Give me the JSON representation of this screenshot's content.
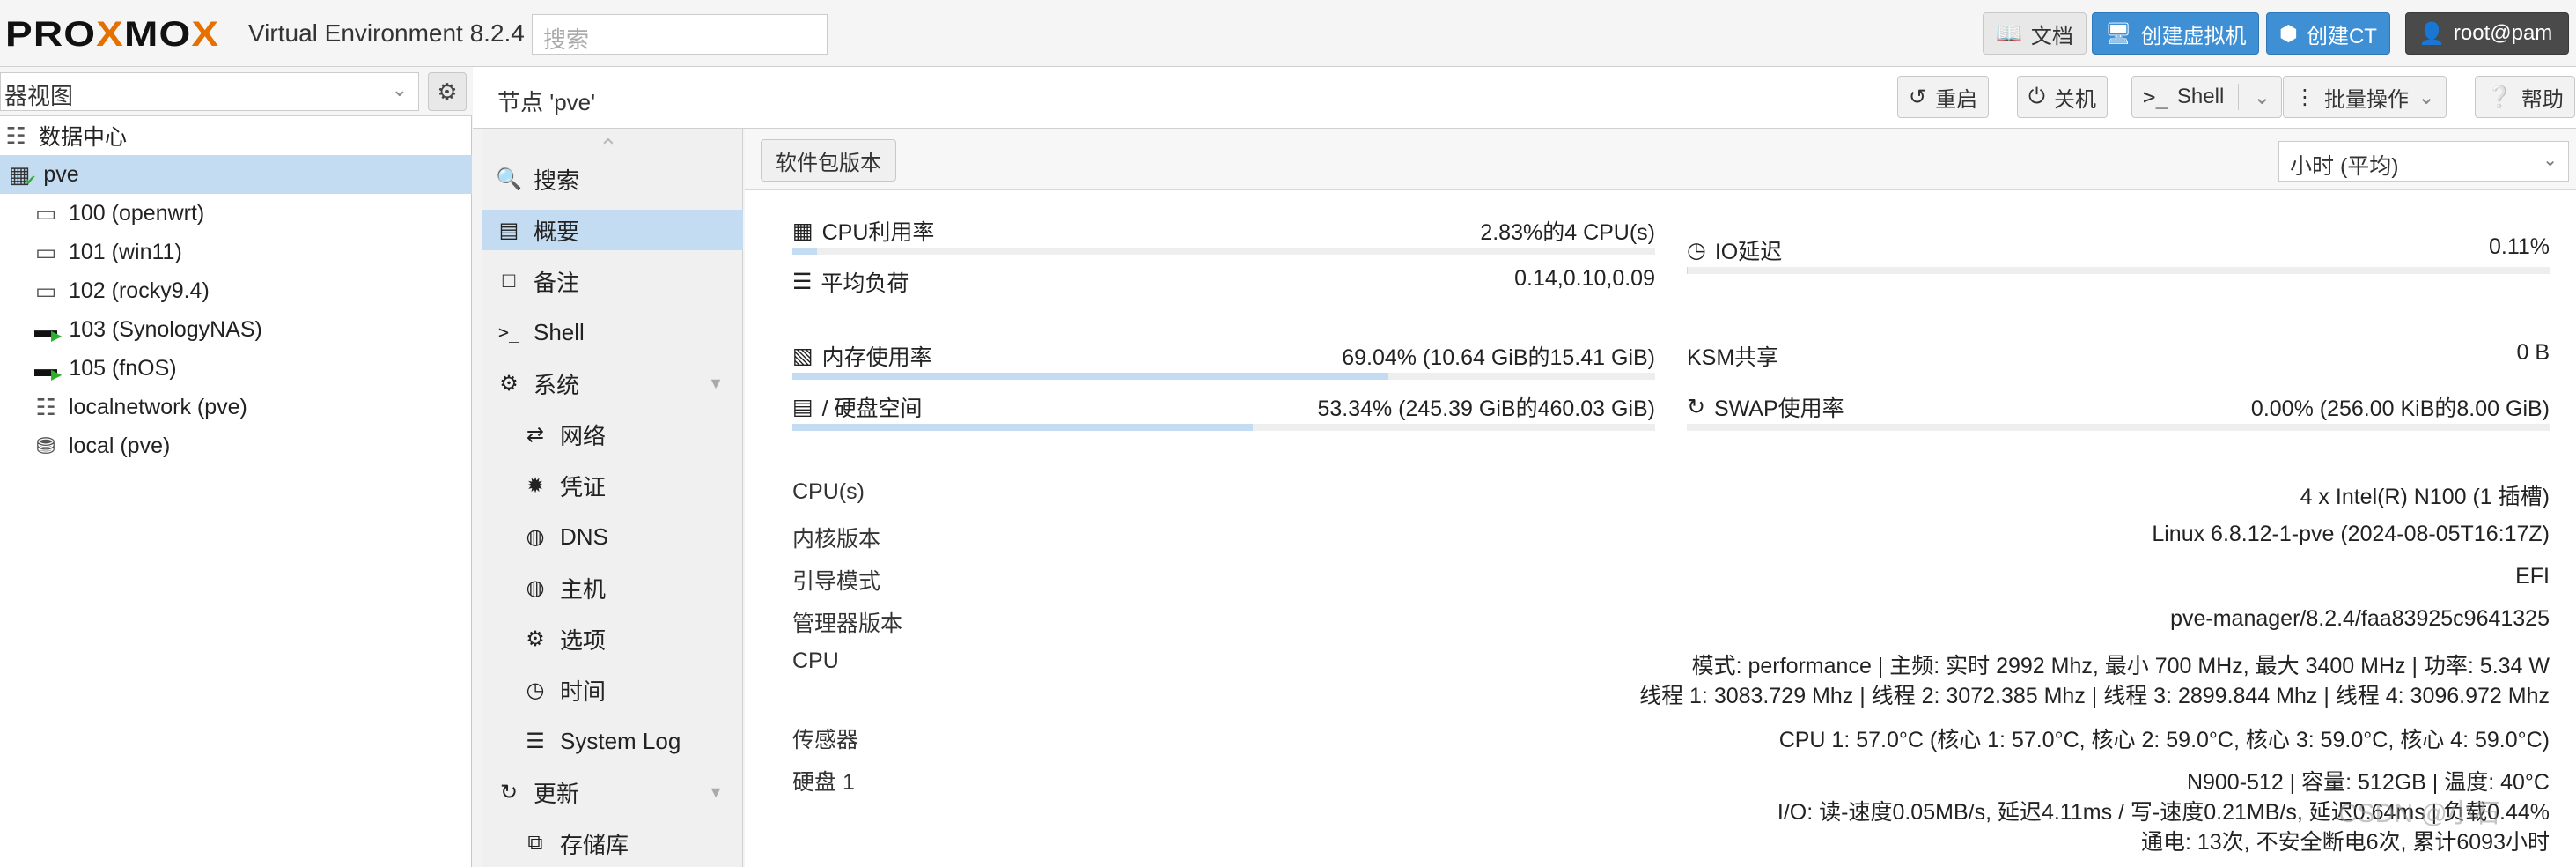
{
  "topbar": {
    "logo_prefix": "PRO",
    "logo_x": "X",
    "logo_suffix": "MO",
    "logo_x2": "X",
    "version": "Virtual Environment 8.2.4",
    "search_placeholder": "搜索",
    "docs_label": "文档",
    "create_vm_label": "创建虚拟机",
    "create_ct_label": "创建CT",
    "user_label": "root@pam"
  },
  "left": {
    "view_selector": "器视图",
    "tree": [
      {
        "label": "数据中心",
        "icon": "building-icon"
      },
      {
        "label": "pve",
        "icon": "server-online-icon",
        "selected": true
      },
      {
        "label": "100 (openwrt)",
        "icon": "vm-stopped-icon"
      },
      {
        "label": "101 (win11)",
        "icon": "vm-stopped-icon"
      },
      {
        "label": "102 (rocky9.4)",
        "icon": "vm-stopped-icon"
      },
      {
        "label": "103 (SynologyNAS)",
        "icon": "vm-running-icon"
      },
      {
        "label": "105 (fnOS)",
        "icon": "vm-running-icon"
      },
      {
        "label": "localnetwork (pve)",
        "icon": "network-grid-icon"
      },
      {
        "label": "local (pve)",
        "icon": "storage-icon"
      }
    ]
  },
  "node_header": {
    "title": "节点 'pve'",
    "reboot": "重启",
    "shutdown": "关机",
    "shell": "Shell",
    "bulk": "批量操作",
    "help": "帮助"
  },
  "nav": [
    {
      "label": "搜索",
      "icon": "search-icon",
      "sub": false
    },
    {
      "label": "概要",
      "icon": "book-icon",
      "sub": false,
      "selected": true
    },
    {
      "label": "备注",
      "icon": "note-icon",
      "sub": false
    },
    {
      "label": "Shell",
      "icon": "terminal-icon",
      "sub": false
    },
    {
      "label": "系统",
      "icon": "cogs-icon",
      "sub": false,
      "expandable": true
    },
    {
      "label": "网络",
      "icon": "exchange-icon",
      "sub": true
    },
    {
      "label": "凭证",
      "icon": "certificate-icon",
      "sub": true
    },
    {
      "label": "DNS",
      "icon": "globe-icon",
      "sub": true
    },
    {
      "label": "主机",
      "icon": "globe-icon",
      "sub": true
    },
    {
      "label": "选项",
      "icon": "gear-icon",
      "sub": true
    },
    {
      "label": "时间",
      "icon": "clock-icon",
      "sub": true
    },
    {
      "label": "System Log",
      "icon": "list-icon",
      "sub": true
    },
    {
      "label": "更新",
      "icon": "refresh-icon",
      "sub": false,
      "expandable": true
    },
    {
      "label": "存储库",
      "icon": "repository-icon",
      "sub": true
    }
  ],
  "content": {
    "pkg_button": "软件包版本",
    "timeframe": "小时 (平均)",
    "stats": {
      "cpu": {
        "label": "CPU利用率",
        "value": "2.83%的4 CPU(s)",
        "fraction": 0.0283
      },
      "load": {
        "label": "平均负荷",
        "value": "0.14,0.10,0.09"
      },
      "io": {
        "label": "IO延迟",
        "value": "0.11%",
        "fraction": 0.0011
      },
      "mem": {
        "label": "内存使用率",
        "value": "69.04% (10.64 GiB的15.41 GiB)",
        "fraction": 0.6904
      },
      "ksm": {
        "label": "KSM共享",
        "value": "0 B"
      },
      "disk": {
        "label": "/ 硬盘空间",
        "value": "53.34% (245.39 GiB的460.03 GiB)",
        "fraction": 0.5334
      },
      "swap": {
        "label": "SWAP使用率",
        "value": "0.00% (256.00 KiB的8.00 GiB)",
        "fraction": 0.0
      }
    },
    "info": {
      "cpus_label": "CPU(s)",
      "cpus_value": "4 x Intel(R) N100 (1 插槽)",
      "kernel_label": "内核版本",
      "kernel_value": "Linux 6.8.12-1-pve (2024-08-05T16:17Z)",
      "boot_label": "引导模式",
      "boot_value": "EFI",
      "manager_label": "管理器版本",
      "manager_value": "pve-manager/8.2.4/faa83925c9641325",
      "cpu_label": "CPU",
      "cpu_line1": "模式: performance | 主频: 实时 2992 Mhz, 最小 700 MHz, 最大 3400 MHz | 功率: 5.34 W",
      "cpu_line2": "线程 1: 3083.729 Mhz | 线程 2: 3072.385 Mhz | 线程 3: 2899.844 Mhz | 线程 4: 3096.972 Mhz",
      "sensor_label": "传感器",
      "sensor_value": "CPU 1: 57.0°C (核心 1: 57.0°C, 核心 2: 59.0°C, 核心 3: 59.0°C, 核心 4: 59.0°C)",
      "disk_label": "硬盘 1",
      "disk_line1": "N900-512 | 容量: 512GB | 温度: 40°C",
      "disk_line2": "I/O: 读-速度0.05MB/s, 延迟4.11ms / 写-速度0.21MB/s, 延迟0.64ms | 负载0.44%",
      "disk_line3": "通电: 13次, 不安全断电6次, 累计6093小时"
    },
    "watermark": "CSDN @小石"
  }
}
